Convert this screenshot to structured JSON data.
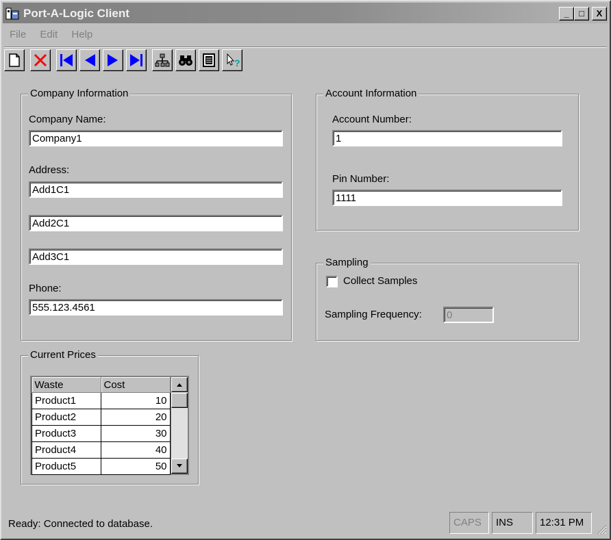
{
  "window": {
    "title": "Port-A-Logic Client",
    "controls": {
      "minimize": "_",
      "maximize": "□",
      "close": "X"
    }
  },
  "menu": [
    "File",
    "Edit",
    "Help"
  ],
  "toolbar": [
    {
      "name": "new-document-icon"
    },
    {
      "name": "delete-icon"
    },
    {
      "name": "first-record-icon"
    },
    {
      "name": "previous-record-icon"
    },
    {
      "name": "next-record-icon"
    },
    {
      "name": "last-record-icon"
    },
    {
      "name": "network-icon"
    },
    {
      "name": "binoculars-find-icon"
    },
    {
      "name": "record-list-icon"
    },
    {
      "name": "help-pointer-icon"
    }
  ],
  "company": {
    "group_title": "Company Information",
    "name_label": "Company Name:",
    "name_value": "Company1",
    "address_label": "Address:",
    "address1": "Add1C1",
    "address2": "Add2C1",
    "address3": "Add3C1",
    "phone_label": "Phone:",
    "phone_value": "555.123.4561"
  },
  "account": {
    "group_title": "Account Information",
    "number_label": "Account Number:",
    "number_value": "1",
    "pin_label": "Pin Number:",
    "pin_value": "1111"
  },
  "sampling": {
    "group_title": "Sampling",
    "collect_label": "Collect Samples",
    "collect_checked": false,
    "frequency_label": "Sampling Frequency:",
    "frequency_value": "0"
  },
  "prices": {
    "group_title": "Current Prices",
    "columns": [
      "Waste",
      "Cost"
    ],
    "rows": [
      {
        "waste": "Product1",
        "cost": "10"
      },
      {
        "waste": "Product2",
        "cost": "20"
      },
      {
        "waste": "Product3",
        "cost": "30"
      },
      {
        "waste": "Product4",
        "cost": "40"
      },
      {
        "waste": "Product5",
        "cost": "50"
      }
    ]
  },
  "status": {
    "message": "Ready: Connected to database.",
    "caps": "CAPS",
    "ins": "INS",
    "time": "12:31 PM"
  },
  "colors": {
    "title_bar": "#808080",
    "face": "#c0c0c0",
    "nav_arrows": "#0000ff",
    "delete": "#ff0000"
  }
}
